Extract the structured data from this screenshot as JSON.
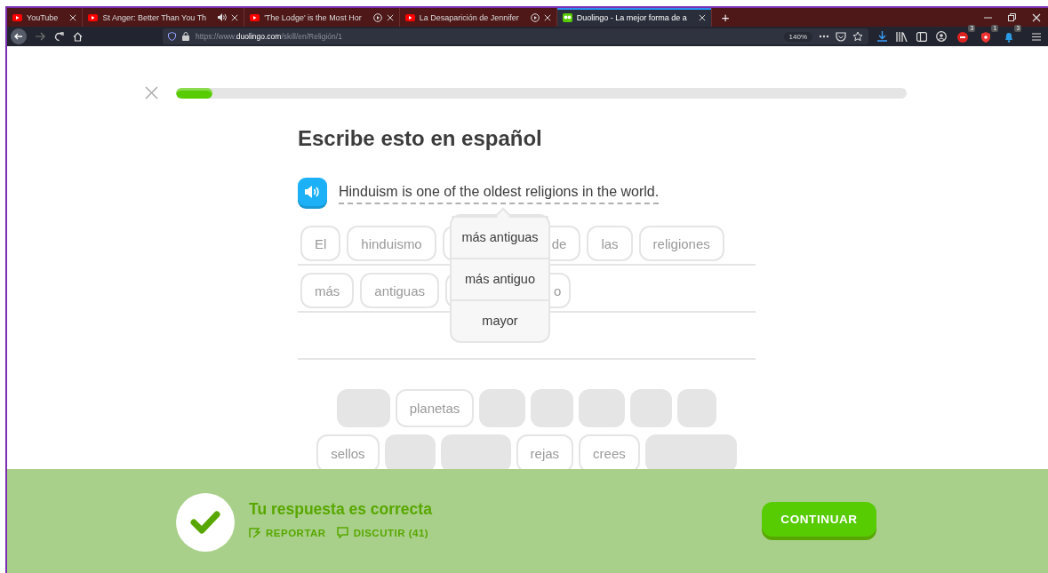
{
  "browser": {
    "tabs": [
      {
        "title": "YouTube",
        "kind": "video",
        "selected": false
      },
      {
        "title": "St Anger: Better Than You Th",
        "kind": "audio",
        "selected": false
      },
      {
        "title": "'The Lodge' is the Most Hor",
        "kind": "playing",
        "selected": false
      },
      {
        "title": "La Desaparición de Jennifer",
        "kind": "playing",
        "selected": false
      },
      {
        "title": "Duolingo - La mejor forma de a",
        "kind": "app",
        "selected": true
      }
    ],
    "new_tab": "+",
    "url": "https://www.**duolingo.com**/skill/en/Religión/1",
    "zoom": "140%",
    "extensions": [
      {
        "kind": "abp",
        "badge": "3"
      },
      {
        "kind": "shield",
        "badge": "1"
      },
      {
        "kind": "bell",
        "badge": "3"
      }
    ]
  },
  "lesson": {
    "progress": {
      "level": 0.05
    },
    "heading": "Escribe esto en español",
    "sentence": "Hinduism is one of the oldest religions in the world.",
    "answer_rows": [
      [
        {
          "kind": "word",
          "text": "El"
        },
        {
          "kind": "word",
          "text": "hinduismo"
        },
        {
          "kind": "covered"
        },
        {
          "kind": "word",
          "text": "de"
        },
        {
          "kind": "word",
          "text": "las"
        },
        {
          "kind": "word",
          "text": "religiones"
        }
      ],
      [
        {
          "kind": "word",
          "text": "más"
        },
        {
          "kind": "word",
          "text": "antiguas"
        },
        {
          "kind": "covered"
        },
        {
          "kind": "partial",
          "text": "o"
        }
      ],
      []
    ],
    "hint_popup": [
      "más antiguas",
      "más antiguo",
      "mayor"
    ],
    "word_bank": [
      [
        {
          "kind": "used"
        },
        {
          "kind": "word",
          "text": "planetas"
        },
        {
          "kind": "used"
        },
        {
          "kind": "used"
        },
        {
          "kind": "used"
        },
        {
          "kind": "used"
        },
        {
          "kind": "used"
        }
      ],
      [
        {
          "kind": "word",
          "text": "sellos"
        },
        {
          "kind": "used"
        },
        {
          "kind": "used"
        },
        {
          "kind": "word",
          "text": "rejas"
        },
        {
          "kind": "word",
          "text": "crees"
        },
        {
          "kind": "used"
        }
      ]
    ]
  },
  "feedback": {
    "correct": true,
    "title": "Tu respuesta es correcta",
    "actions": [
      {
        "kind": "report",
        "label": "REPORTAR"
      },
      {
        "kind": "discuss",
        "label": "DISCUTIR (41)"
      }
    ],
    "button": "CONTINUAR"
  }
}
